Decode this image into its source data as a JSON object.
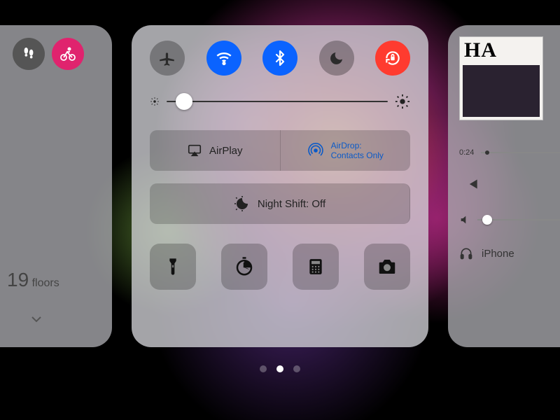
{
  "colors": {
    "accent_blue": "#0a63ff",
    "accent_red": "#ff3b2f",
    "accent_pink": "#e0236e"
  },
  "left_panel": {
    "floors_value": "19",
    "floors_unit": "floors"
  },
  "center_panel": {
    "toggles": {
      "airplane": {
        "active": false
      },
      "wifi": {
        "active": true
      },
      "bluetooth": {
        "active": true
      },
      "dnd": {
        "active": false
      },
      "rotation_lock": {
        "active": true
      }
    },
    "brightness_percent": 8,
    "airplay_label": "AirPlay",
    "airdrop_label_line1": "AirDrop:",
    "airdrop_label_line2": "Contacts Only",
    "nightshift_label": "Night Shift: Off"
  },
  "right_panel": {
    "album_title": "HA",
    "elapsed": "0:24",
    "device_label": "iPhone"
  },
  "page_dots": {
    "count": 3,
    "active_index": 1
  }
}
